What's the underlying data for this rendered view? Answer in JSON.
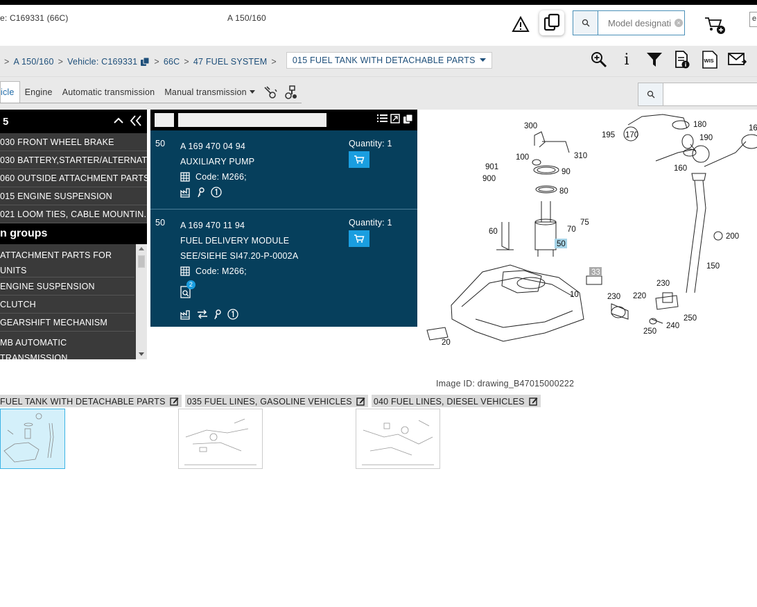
{
  "header": {
    "vehicle_text": "e: C169331 (66C)",
    "model_text": "A 150/160",
    "search_placeholder": "Model designati",
    "lang_text": "e"
  },
  "breadcrumb": {
    "items": [
      "A 150/160",
      "Vehicle: C169331",
      "66C",
      "47 FUEL SYSTEM"
    ],
    "selected": "015 FUEL TANK WITH DETACHABLE PARTS"
  },
  "tabs": {
    "items": [
      "icle",
      "Engine",
      "Automatic transmission",
      "Manual transmission"
    ]
  },
  "left_panel": {
    "header": "5",
    "items": [
      "030 FRONT WHEEL BRAKE",
      "030 BATTERY,STARTER/ALTERNAT...",
      "060 OUTSIDE ATTACHMENT PARTS",
      "015 ENGINE SUSPENSION",
      "021 LOOM TIES, CABLE MOUNTIN..."
    ],
    "section_title": "n groups",
    "groups": [
      "ATTACHMENT PARTS FOR UNITS",
      "ENGINE SUSPENSION",
      "CLUTCH",
      "GEARSHIFT MECHANISM",
      "MB AUTOMATIC TRANSMISSION"
    ]
  },
  "parts": [
    {
      "pos": "50",
      "number": "A 169 470 04 94",
      "name": "AUXILIARY PUMP",
      "code": "Code: M266;",
      "quantity": "Quantity: 1"
    },
    {
      "pos": "50",
      "number": "A 169 470 11 94",
      "name": "FUEL DELIVERY MODULE",
      "note": "SEE/SIEHE SI47.20-P-0002A",
      "code": "Code: M266;",
      "quantity": "Quantity: 1",
      "badge": "2"
    }
  ],
  "drawing": {
    "labels": [
      "300",
      "195",
      "170",
      "180",
      "190",
      "16",
      "100",
      "310",
      "901",
      "90",
      "900",
      "160",
      "80",
      "60",
      "75",
      "70",
      "50",
      "200",
      "33",
      "150",
      "10",
      "230",
      "230",
      "220",
      "250",
      "250",
      "240",
      "20"
    ],
    "image_id": "Image ID: drawing_B47015000222"
  },
  "thumbnails": [
    {
      "label": "FUEL TANK WITH DETACHABLE PARTS"
    },
    {
      "label": "035 FUEL LINES, GASOLINE VEHICLES"
    },
    {
      "label": "040 FUEL LINES, DIESEL VEHICLES"
    }
  ],
  "colors": {
    "panel_blue": "#063f5c",
    "cart_blue": "#1a9ee0",
    "link_blue": "#1e4f7a"
  }
}
